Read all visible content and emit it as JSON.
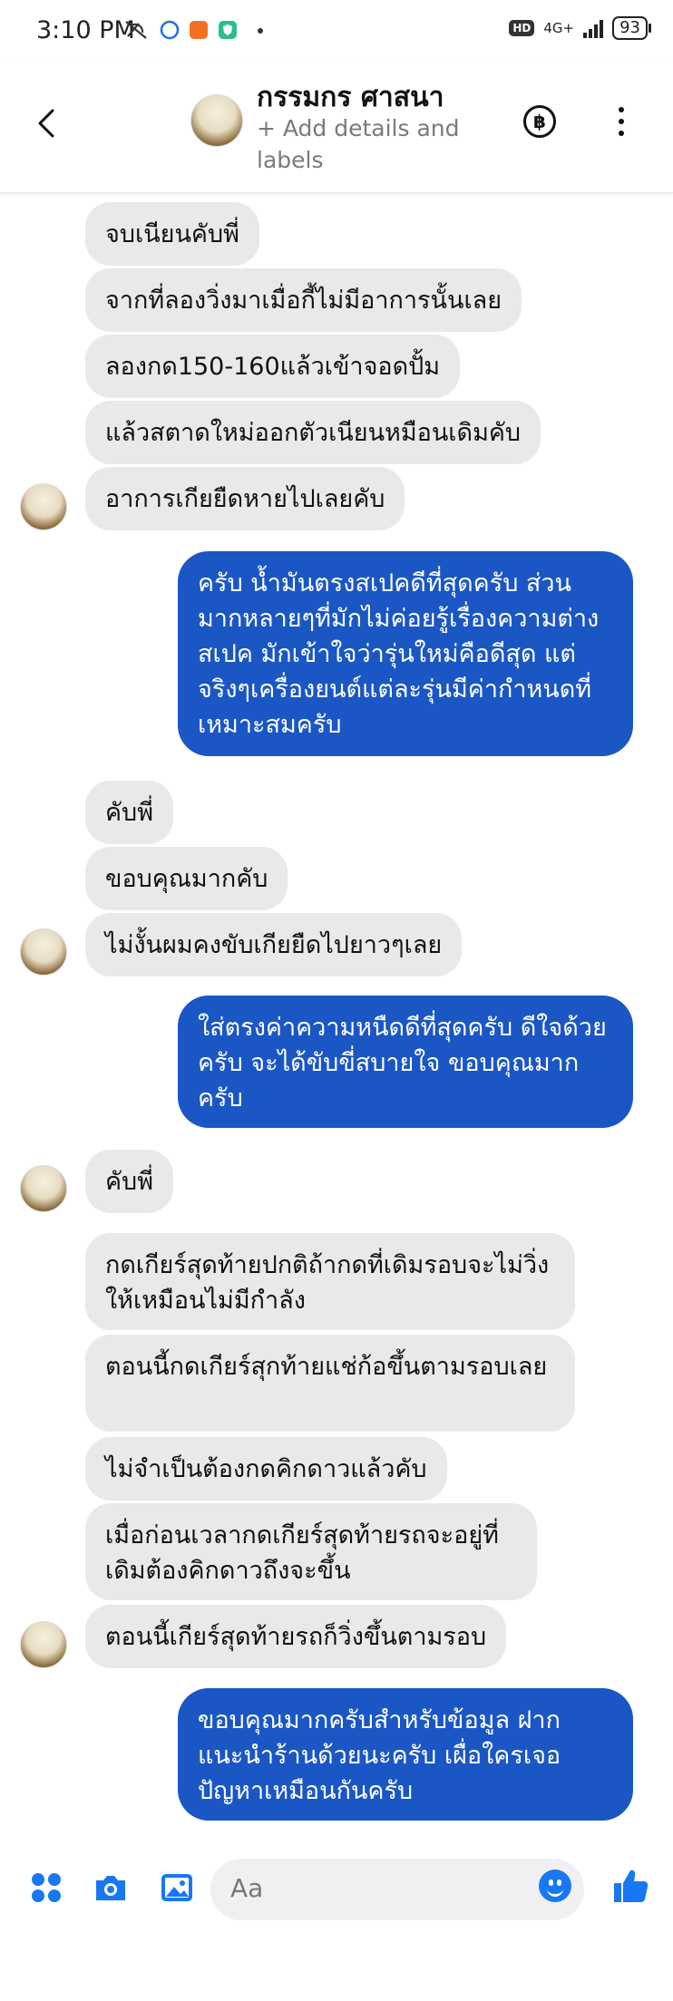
{
  "status_bar": {
    "time": "3:10 PM",
    "network": "4G+",
    "battery": "93",
    "hd": "HD"
  },
  "header": {
    "contact_name": "กรรมกร ศาสนา",
    "subtitle": "+ Add details and labels",
    "baht_symbol": "฿"
  },
  "messages": [
    {
      "dir": "in",
      "text": "จบเนียนคับพี่"
    },
    {
      "dir": "in",
      "text": "จากที่ลองวิ่งมาเมื่อกี้ไม่มีอาการนั้นเลย"
    },
    {
      "dir": "in",
      "text": "ลองกด150-160แล้วเข้าจอดปั้ม"
    },
    {
      "dir": "in",
      "text": "แล้วสตาดใหม่ออกตัวเนียนหมือนเดิมคับ"
    },
    {
      "dir": "in",
      "text": "อาการเกียยืดหายไปเลยคับ"
    },
    {
      "dir": "out",
      "text": "ครับ น้ำมันตรงสเปคดีที่สุดครับ  ส่วนมากหลายๆที่มักไม่ค่อยรู้เรื่องความต่างสเปค  มักเข้าใจว่ารุ่นใหม่คือดีสุด แต่จริงๆเครื่องยนต์แต่ละรุ่นมีค่ากำหนดที่เหมาะสมครับ"
    },
    {
      "dir": "in",
      "text": "คับพี่"
    },
    {
      "dir": "in",
      "text": "ขอบคุณมากคับ"
    },
    {
      "dir": "in",
      "text": "ไม่งั้นผมคงขับเกียยืดไปยาวๆเลย"
    },
    {
      "dir": "out",
      "text": "ใส่ตรงค่าความหนืดดีที่สุดครับ  ดีใจด้วยครับ จะได้ขับขี่สบายใจ  ขอบคุณมากครับ"
    },
    {
      "dir": "in",
      "text": "คับพี่"
    },
    {
      "dir": "in",
      "text": "กดเกียร์สุดท้ายปกติถ้ากดที่เดิมรอบจะไม่วิ่งให้เหมือนไม่มีกำลัง"
    },
    {
      "dir": "in",
      "text": "ตอนนี้กดเกียร์สุกท้ายแช่ก้อขึ้นตามรอบเลย"
    },
    {
      "dir": "in",
      "text": "ไม่จำเป็นต้องกดคิกดาวแล้วคับ"
    },
    {
      "dir": "in",
      "text": "เมื่อก่อนเวลากดเกียร์สุดท้ายรถจะอยู่ที่เดิมต้องคิกดาวถึงจะขึ้น"
    },
    {
      "dir": "in",
      "text": "ตอนนี้เกียร์สุดท้ายรถก็วิ่งขึ้นตามรอบ"
    },
    {
      "dir": "out",
      "text": "ขอบคุณมากครับสำหรับข้อมูล  ฝากแนะนำร้านด้วยนะครับ เผื่อใครเจอปัญหาเหมือนกันครับ"
    }
  ],
  "composer": {
    "placeholder": "Aa"
  },
  "colors": {
    "outgoing": "#1a57c4",
    "incoming": "#e9e9eb",
    "accent": "#1877f2"
  },
  "icons": [
    "back-arrow-icon",
    "baht-icon",
    "more-vertical-icon",
    "apps-icon",
    "camera-icon",
    "gallery-icon",
    "emoji-icon",
    "like-icon"
  ]
}
